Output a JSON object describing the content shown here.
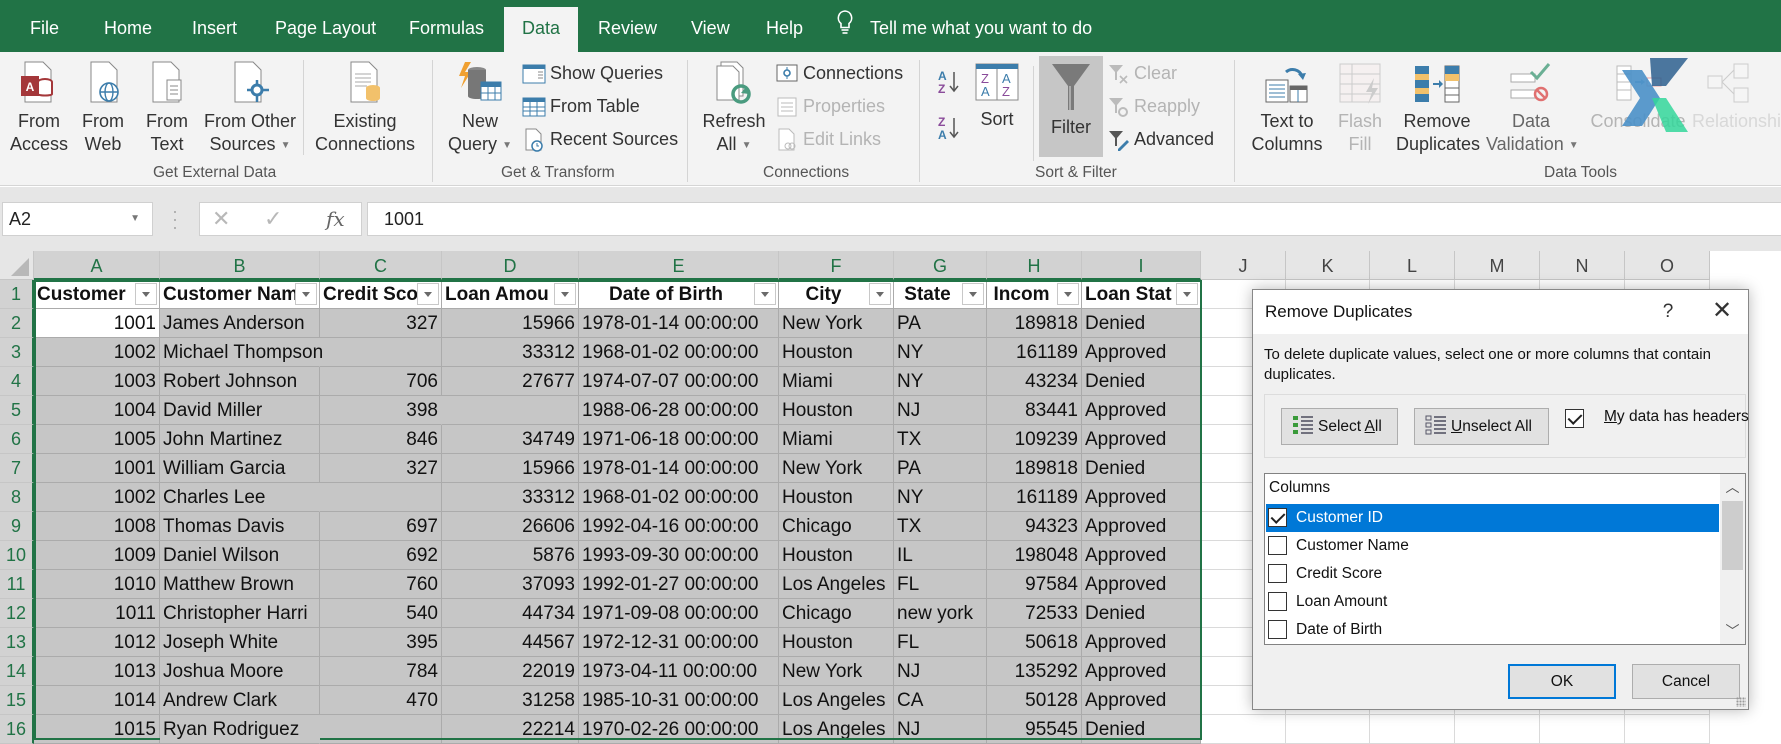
{
  "app": {
    "tabs": [
      {
        "label": "File",
        "active": false
      },
      {
        "label": "Home",
        "active": false
      },
      {
        "label": "Insert",
        "active": false
      },
      {
        "label": "Page Layout",
        "active": false
      },
      {
        "label": "Formulas",
        "active": false
      },
      {
        "label": "Data",
        "active": true
      },
      {
        "label": "Review",
        "active": false
      },
      {
        "label": "View",
        "active": false
      },
      {
        "label": "Help",
        "active": false
      }
    ],
    "tell_me": "Tell me what you want to do"
  },
  "ribbon": {
    "get_external_data": {
      "group_label": "Get External Data",
      "from_access": [
        "From",
        "Access"
      ],
      "from_web": [
        "From",
        "Web"
      ],
      "from_text": [
        "From",
        "Text"
      ],
      "from_other": [
        "From Other",
        "Sources"
      ],
      "existing": [
        "Existing",
        "Connections"
      ]
    },
    "get_transform": {
      "group_label": "Get & Transform",
      "new_query": [
        "New",
        "Query"
      ],
      "show_queries": "Show Queries",
      "from_table": "From Table",
      "recent_sources": "Recent Sources"
    },
    "connections": {
      "group_label": "Connections",
      "refresh_all": [
        "Refresh",
        "All"
      ],
      "connections": "Connections",
      "properties": "Properties",
      "edit_links": "Edit Links"
    },
    "sort_filter": {
      "group_label": "Sort & Filter",
      "sort": "Sort",
      "filter": "Filter",
      "clear": "Clear",
      "reapply": "Reapply",
      "advanced": "Advanced"
    },
    "data_tools": {
      "group_label": "Data Tools",
      "text_to_columns": [
        "Text to",
        "Columns"
      ],
      "flash_fill": [
        "Flash",
        "Fill"
      ],
      "remove_duplicates": [
        "Remove",
        "Duplicates"
      ],
      "data_validation": [
        "Data",
        "Validation"
      ],
      "consolidate": "Consolidate",
      "relationships": "Relationshi"
    }
  },
  "formula_bar": {
    "name_box": "A2",
    "value": "1001",
    "fx": "fx"
  },
  "sheet": {
    "columns": [
      "A",
      "B",
      "C",
      "D",
      "E",
      "F",
      "G",
      "H",
      "I",
      "J",
      "K",
      "L",
      "M",
      "N",
      "O"
    ],
    "headers": [
      "Customer",
      "Customer Nam",
      "Credit Sco",
      "Loan Amou",
      "Date of Birth",
      "City",
      "State",
      "Incom",
      "Loan Stat"
    ],
    "row_numbers": [
      "1",
      "2",
      "3",
      "4",
      "5",
      "6",
      "7",
      "8",
      "9",
      "10",
      "11",
      "12",
      "13",
      "14",
      "15",
      "16"
    ],
    "rows": [
      [
        "1001",
        "James Anderson",
        "327",
        "15966",
        "1978-01-14 00:00:00",
        "New York",
        "PA",
        "189818",
        "Denied"
      ],
      [
        "1002",
        "Michael Thompson",
        "",
        "33312",
        "1968-01-02 00:00:00",
        "Houston",
        "NY",
        "161189",
        "Approved"
      ],
      [
        "1003",
        "Robert Johnson",
        "706",
        "27677",
        "1974-07-07 00:00:00",
        "Miami",
        "NY",
        "43234",
        "Denied"
      ],
      [
        "1004",
        "David Miller",
        "398",
        "",
        "1988-06-28 00:00:00",
        "Houston",
        "NJ",
        "83441",
        "Approved"
      ],
      [
        "1005",
        "John Martinez",
        "846",
        "34749",
        "1971-06-18 00:00:00",
        "Miami",
        "TX",
        "109239",
        "Approved"
      ],
      [
        "1001",
        "William Garcia",
        "327",
        "15966",
        "1978-01-14 00:00:00",
        "New York",
        "PA",
        "189818",
        "Denied"
      ],
      [
        "1002",
        "Charles Lee",
        "",
        "33312",
        "1968-01-02 00:00:00",
        "Houston",
        "NY",
        "161189",
        "Approved"
      ],
      [
        "1008",
        "Thomas Davis",
        "697",
        "26606",
        "1992-04-16 00:00:00",
        "Chicago",
        "TX",
        "94323",
        "Approved"
      ],
      [
        "1009",
        "Daniel Wilson",
        "692",
        "5876",
        "1993-09-30 00:00:00",
        "Houston",
        "IL",
        "198048",
        "Approved"
      ],
      [
        "1010",
        "Matthew Brown",
        "760",
        "37093",
        "1992-01-27 00:00:00",
        "Los Angeles",
        "FL",
        "97584",
        "Approved"
      ],
      [
        "1011",
        "Christopher Harri",
        "540",
        "44734",
        "1971-09-08 00:00:00",
        "Chicago",
        "new york",
        "72533",
        "Denied"
      ],
      [
        "1012",
        "Joseph White",
        "395",
        "44567",
        "1972-12-31 00:00:00",
        "Houston",
        "FL",
        "50618",
        "Approved"
      ],
      [
        "1013",
        "Joshua Moore",
        "784",
        "22019",
        "1973-04-11 00:00:00",
        "New York",
        "NJ",
        "135292",
        "Approved"
      ],
      [
        "1014",
        "Andrew Clark",
        "470",
        "31258",
        "1985-10-31 00:00:00",
        "Los Angeles",
        "CA",
        "50128",
        "Approved"
      ],
      [
        "1015",
        "Ryan Rodriguez",
        "",
        "22214",
        "1970-02-26 00:00:00",
        "Los Angeles",
        "NJ",
        "95545",
        "Denied"
      ]
    ]
  },
  "dialog": {
    "title": "Remove Duplicates",
    "help": "?",
    "close": "✕",
    "description": "To delete duplicate values, select one or more columns that contain duplicates.",
    "select_all": {
      "pre": "Select ",
      "ul": "A",
      "post": "ll"
    },
    "unselect_all": {
      "pre": "",
      "ul": "U",
      "post": "nselect All"
    },
    "headers_checkbox": {
      "ul": "M",
      "post": "y data has headers",
      "checked": true
    },
    "list_header": "Columns",
    "columns": [
      {
        "label": "Customer ID",
        "checked": true,
        "selected": true
      },
      {
        "label": "Customer Name",
        "checked": false,
        "selected": false
      },
      {
        "label": "Credit Score",
        "checked": false,
        "selected": false
      },
      {
        "label": "Loan Amount",
        "checked": false,
        "selected": false
      },
      {
        "label": "Date of Birth",
        "checked": false,
        "selected": false
      }
    ],
    "ok": "OK",
    "cancel": "Cancel"
  },
  "colors": {
    "excel_green": "#217346",
    "selection_blue": "#0078d7",
    "selected_range": "#c6c6c6"
  }
}
